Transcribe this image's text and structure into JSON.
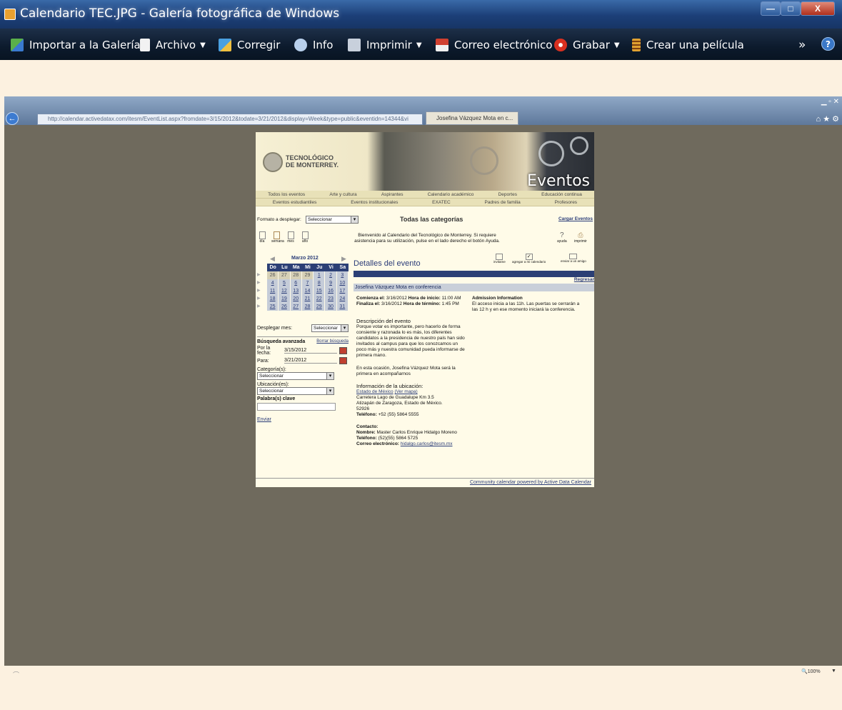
{
  "window": {
    "title": "Calendario TEC.JPG - Galería fotográfica de Windows",
    "minimize": "—",
    "maximize": "□",
    "close": "X"
  },
  "toolbar": {
    "import": "Importar a la Galería",
    "file": "Archivo",
    "fix": "Corregir",
    "info": "Info",
    "print": "Imprimir",
    "email": "Correo electrónico",
    "burn": "Grabar",
    "movie": "Crear una película",
    "more": "»",
    "help": "?"
  },
  "browser": {
    "url": "http://calendar.activedatax.com/itesm/EventList.aspx?fromdate=3/15/2012&todate=3/21/2012&display=Week&type=public&eventidn=14344&vi",
    "tab_title": "Josefina Vázquez Mota en c...",
    "icons": "⌂ ★ ⚙",
    "zoom": "🔍100%"
  },
  "site": {
    "logo_line1": "TECNOLÓGICO",
    "logo_line2": "DE MONTERREY.",
    "banner_word": "Eventos",
    "nav_row1": [
      "Todos los eventos",
      "Arte y cultura",
      "Aspirantes",
      "Calendario académico",
      "Deportes",
      "Educación continua"
    ],
    "nav_row2": [
      "Eventos estudiantiles",
      "Eventos institucionales",
      "EXATEC",
      "Padres de familia",
      "Profesores"
    ],
    "format_label": "Formato a desplegar:",
    "format_value": "Seleccionar",
    "all_categories": "Todas las categorías",
    "load_events": "Cargar Eventos",
    "view_icons": [
      "día",
      "semana",
      "mes",
      "año"
    ],
    "welcome": "Bienvenido al Calendario del Tecnológico de Monterrey. Si requiere asistencia para su utilización, pulse en el lado derecho el botón Ayuda.",
    "help": "ayuda",
    "print": "imprimir",
    "month_title": "Marzo 2012",
    "day_headers": [
      "Do",
      "Lu",
      "Ma",
      "Mi",
      "Ju",
      "Vi",
      "Sa"
    ],
    "weeks": [
      [
        "26",
        "27",
        "28",
        "29",
        "1",
        "2",
        "3"
      ],
      [
        "4",
        "5",
        "6",
        "7",
        "8",
        "9",
        "10"
      ],
      [
        "11",
        "12",
        "13",
        "14",
        "15",
        "16",
        "17"
      ],
      [
        "18",
        "19",
        "20",
        "21",
        "22",
        "23",
        "24"
      ],
      [
        "25",
        "26",
        "27",
        "28",
        "29",
        "30",
        "31"
      ]
    ],
    "show_month_label": "Desplegar mes:",
    "show_month_value": "Seleccionar",
    "advanced_search": "Búsqueda avanzada",
    "clear_search": "Borrar búsqueda",
    "from_label": "Por la fecha:",
    "from_value": "3/15/2012",
    "to_label": "Para:",
    "to_value": "3/21/2012",
    "category_label": "Categoría(s):",
    "category_value": "Seleccionar",
    "location_label": "Ubicación(es):",
    "location_value": "Seleccionar",
    "keyword_label": "Palabra(s) clave",
    "send": "Enviar",
    "details_title": "Detalles del evento",
    "action_icons": [
      "invitame",
      "agregar a mi calendario",
      "enviar a un amigo"
    ],
    "back": "Regresar",
    "event_title": "Josefina Vázquez Mota en conferencia",
    "start_label": "Comienza el:",
    "start_date": "3/16/2012",
    "start_time_label": "Hora de inicio:",
    "start_time": "11:00 AM",
    "end_label": "Finaliza el:",
    "end_date": "3/16/2012",
    "end_time_label": "Hora de término:",
    "end_time": "1:45 PM",
    "admission_title": "Admission Information",
    "admission_text": "El acceso inicia a las 11h. Las puertas se cerrarán a las 12 h y en ese momento iniciará la conferencia.",
    "description_title": "Descripción del evento",
    "description": "Porque votar es importante, pero hacerlo de forma consiente y razonada lo es más, los diferentes candidatos a la presidencia de nuestro país han sido invitados al campus para que los conozcamos un poco más y nuestra comunidad pueda informarse de primera mano.",
    "description2": "En esta ocasión, Josefina Vázquez Mota será la primera en acompañarnos",
    "location_title": "Información de la ubicación:",
    "location_name": "Estado de México",
    "see_map": "(Ver mapa)",
    "address1": "Carretera Lago de Guadalupe Km 3.5",
    "address2": "Atizapán de Zaragoza, Estado de México.",
    "zip": "52926",
    "phone_label": "Teléfono:",
    "phone": "+52 (55) 5864 5555",
    "contact_title": "Contacto:",
    "contact_name_label": "Nombre:",
    "contact_name": "Master Carlos Enrique Hidalgo Moreno",
    "contact_phone_label": "Teléfono:",
    "contact_phone": "(52)(55) 5864 5725",
    "contact_email_label": "Correo electrónico:",
    "contact_email": "hidalgo.carlos@itesm.mx",
    "footer": "Community calendar powered by Active Data Calendar"
  },
  "colors": {
    "titlebar": "#2a4f8c",
    "toolbar": "#0f1d30",
    "desk": "#6f6a5d",
    "calendar_header": "#2b3f75",
    "page_bg": "#fffbe8"
  }
}
